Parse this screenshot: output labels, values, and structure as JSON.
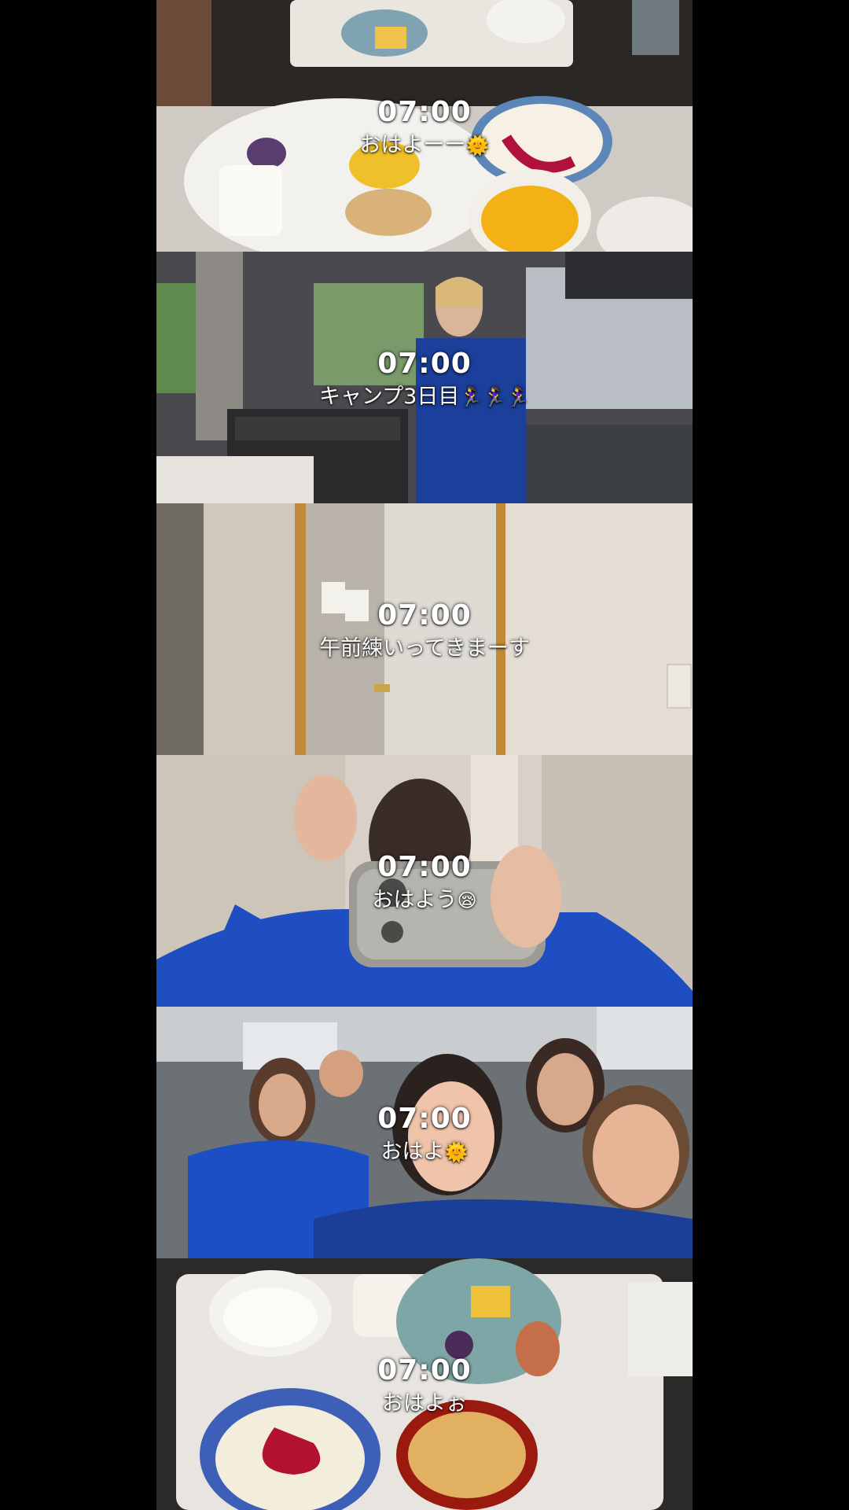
{
  "panels": [
    {
      "time": "07:00",
      "caption": "おはよーー",
      "emoji": "🌞"
    },
    {
      "time": "07:00",
      "caption": "キャンプ3日目",
      "emoji": "🏃‍♀️🏃‍♀️🏃‍♀️"
    },
    {
      "time": "07:00",
      "caption": "午前練いってきまーす",
      "emoji": ""
    },
    {
      "time": "07:00",
      "caption": "おはよう",
      "emoji": "😪"
    },
    {
      "time": "07:00",
      "caption": "おはよ",
      "emoji": "🌞"
    },
    {
      "time": "07:00",
      "caption": "おはよぉ",
      "emoji": ""
    }
  ]
}
